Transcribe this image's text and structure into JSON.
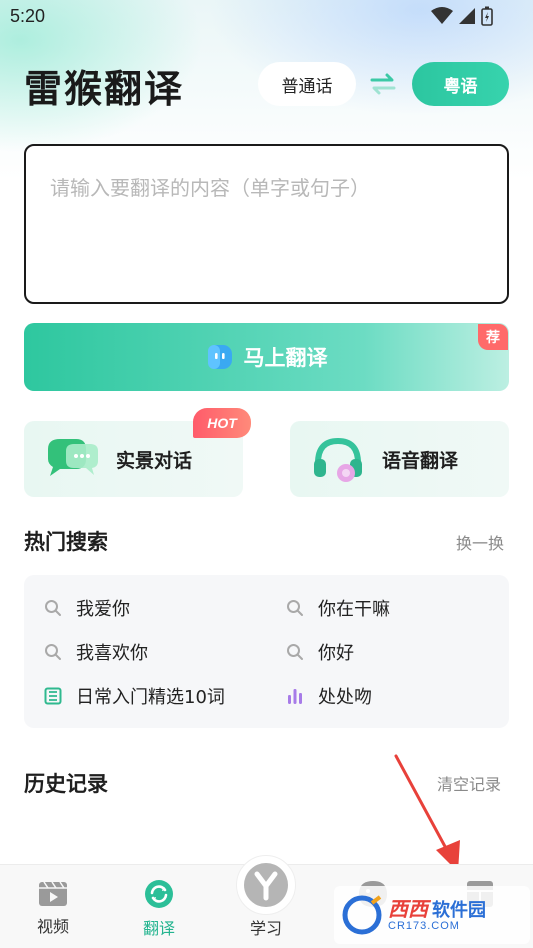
{
  "status_bar": {
    "time": "5:20"
  },
  "header": {
    "logo_text": "雷猴翻译",
    "source_lang": "普通话",
    "target_lang": "粤语"
  },
  "input": {
    "placeholder": "请输入要翻译的内容（单字或句子）"
  },
  "translate_button": {
    "label": "马上翻译",
    "badge": "荐"
  },
  "features": [
    {
      "label": "实景对话",
      "badge": "HOT"
    },
    {
      "label": "语音翻译"
    }
  ],
  "hot_search": {
    "title": "热门搜索",
    "refresh_label": "换一换",
    "items": [
      {
        "text": "我爱你",
        "icon": "search-icon"
      },
      {
        "text": "你在干嘛",
        "icon": "search-icon"
      },
      {
        "text": "我喜欢你",
        "icon": "search-icon"
      },
      {
        "text": "你好",
        "icon": "search-icon"
      },
      {
        "text": "日常入门精选10词",
        "icon": "list-icon"
      },
      {
        "text": "处处吻",
        "icon": "audio-bars-icon"
      }
    ]
  },
  "history": {
    "title": "历史记录",
    "clear_label": "清空记录"
  },
  "bottom_nav": {
    "items": [
      {
        "label": "视频",
        "icon": "video-icon"
      },
      {
        "label": "翻译",
        "icon": "translate-icon",
        "active": true
      },
      {
        "label": "学习",
        "icon": "learn-icon"
      },
      {
        "label": "",
        "icon": "smile-icon"
      },
      {
        "label": "",
        "icon": "grid-icon"
      }
    ]
  },
  "watermark": {
    "logo": "西西",
    "text": "软件园",
    "url": "CR173.COM"
  },
  "colors": {
    "accent": "#2cc6a0",
    "hot_badge": "#ff5b6a",
    "recommend_badge": "#ff6a6a",
    "arrow": "#e8413a"
  }
}
